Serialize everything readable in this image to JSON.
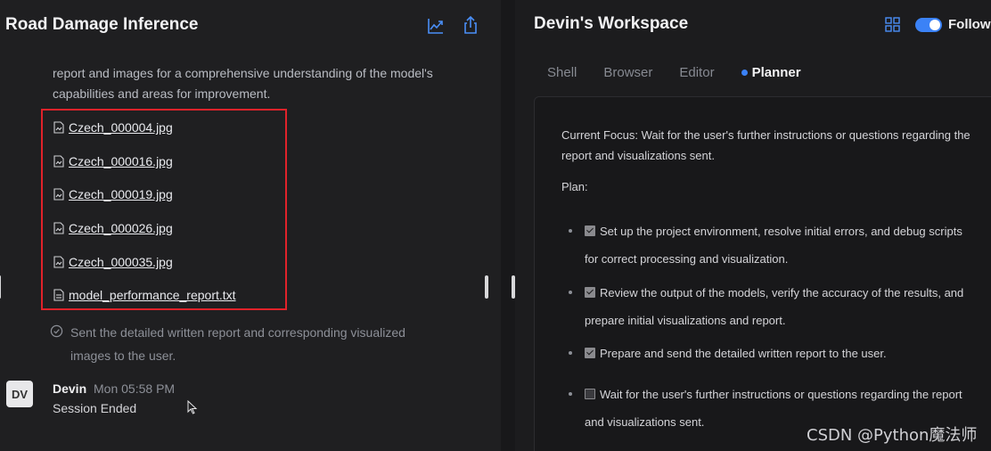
{
  "left_panel": {
    "title": "Road Damage Inference",
    "chart_icon": "line-chart-icon",
    "share_icon": "share-icon",
    "paragraph": "report and images for a comprehensive understanding of the model's capabilities and areas for improvement.",
    "files": [
      "Czech_000004.jpg",
      "Czech_000016.jpg",
      "Czech_000019.jpg",
      "Czech_000026.jpg",
      "Czech_000035.jpg",
      "model_performance_report.txt"
    ],
    "sent_status": "Sent the detailed written report and corresponding visualized images to the user.",
    "message": {
      "avatar": "DV",
      "author": "Devin",
      "time": "Mon 05:58 PM",
      "text": "Session Ended"
    },
    "highlight_color": "#e0222a"
  },
  "workspace": {
    "title": "Devin's Workspace",
    "follow_label": "Followi",
    "tabs": [
      {
        "label": "Shell",
        "active": false
      },
      {
        "label": "Browser",
        "active": false
      },
      {
        "label": "Editor",
        "active": false
      },
      {
        "label": "Planner",
        "active": true
      }
    ],
    "planner": {
      "focus": "Current Focus: Wait for the user's further instructions or questions regarding the report and visualizations sent.",
      "plan_label": "Plan:",
      "items": [
        {
          "text": "Set up the project environment, resolve initial errors, and debug scripts for correct processing and visualization.",
          "checked": true
        },
        {
          "text": "Review the output of the models, verify the accuracy of the results, and prepare initial visualizations and report.",
          "checked": true
        },
        {
          "text": "Prepare and send the detailed written report to the user.",
          "checked": true
        },
        {
          "text": "Wait for the user's further instructions or questions regarding the report and visualizations sent.",
          "checked": false
        }
      ]
    },
    "accent_color": "#3b82f6"
  },
  "watermark": "CSDN @Python魔法师"
}
